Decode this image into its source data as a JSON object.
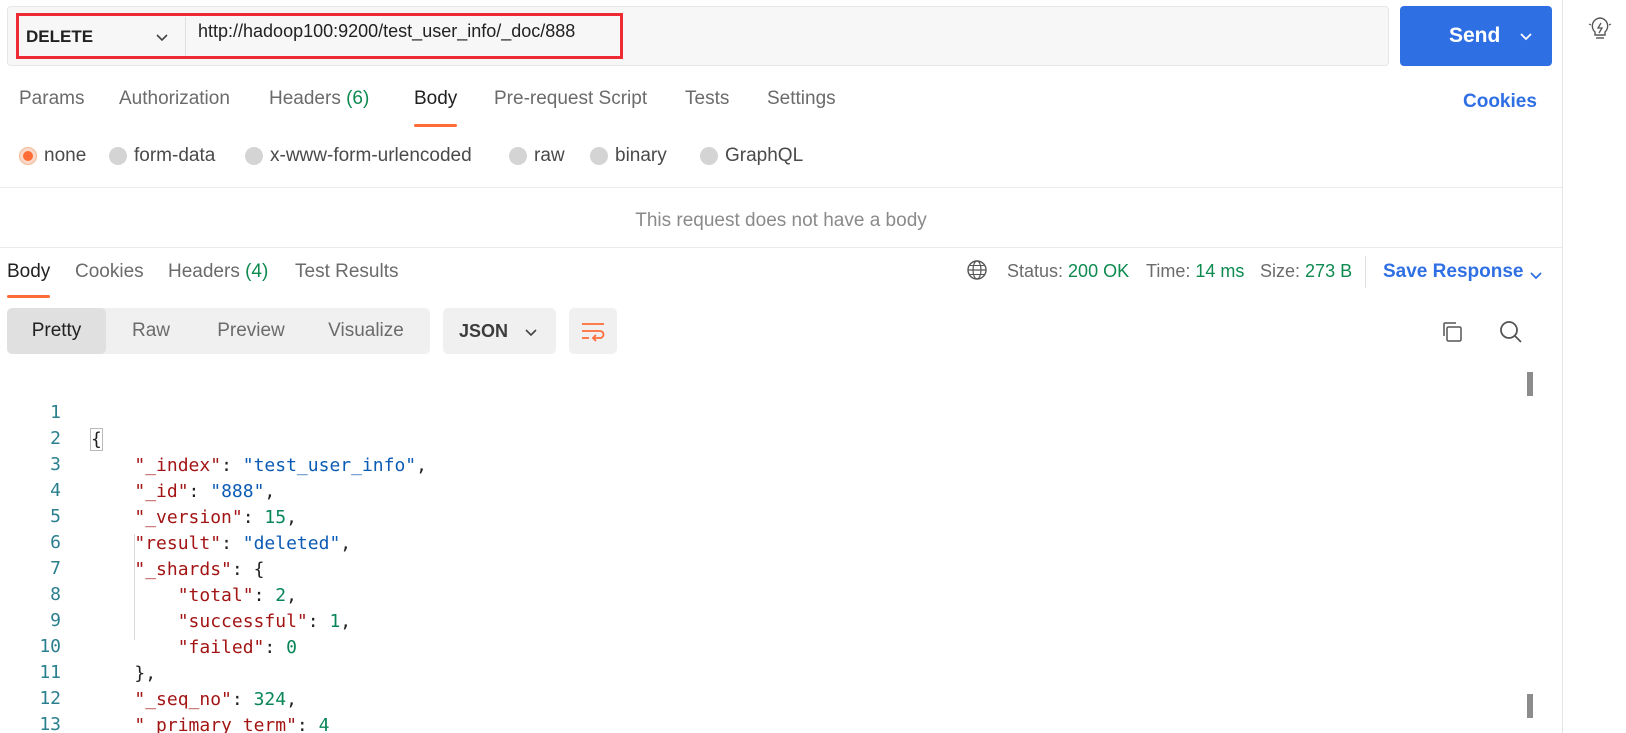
{
  "request": {
    "method": "DELETE",
    "url": "http://hadoop100:9200/test_user_info/_doc/888",
    "send_label": "Send"
  },
  "request_tabs": [
    {
      "label": "Params"
    },
    {
      "label": "Authorization"
    },
    {
      "label": "Headers",
      "count": "(6)"
    },
    {
      "label": "Body"
    },
    {
      "label": "Pre-request Script"
    },
    {
      "label": "Tests"
    },
    {
      "label": "Settings"
    }
  ],
  "cookies_label": "Cookies",
  "body_types": [
    "none",
    "form-data",
    "x-www-form-urlencoded",
    "raw",
    "binary",
    "GraphQL"
  ],
  "no_body_message": "This request does not have a body",
  "response_tabs": [
    {
      "label": "Body"
    },
    {
      "label": "Cookies"
    },
    {
      "label": "Headers",
      "count": "(4)"
    },
    {
      "label": "Test Results"
    }
  ],
  "status": {
    "status_label": "Status:",
    "status_value": "200 OK",
    "time_label": "Time:",
    "time_value": "14 ms",
    "size_label": "Size:",
    "size_value": "273 B"
  },
  "save_response_label": "Save Response",
  "format_buttons": [
    "Pretty",
    "Raw",
    "Preview",
    "Visualize"
  ],
  "language": "JSON",
  "line_numbers": [
    "1",
    "2",
    "3",
    "4",
    "5",
    "6",
    "7",
    "8",
    "9",
    "10",
    "11",
    "12",
    "13"
  ],
  "response_json": {
    "index_key": "\"_index\"",
    "index_value": "\"test_user_info\"",
    "id_key": "\"_id\"",
    "id_value": "\"888\"",
    "version_key": "\"_version\"",
    "version_value": "15",
    "result_key": "\"result\"",
    "result_value": "\"deleted\"",
    "shards_key": "\"_shards\"",
    "total_key": "\"total\"",
    "total_value": "2",
    "successful_key": "\"successful\"",
    "successful_value": "1",
    "failed_key": "\"failed\"",
    "failed_value": "0",
    "seq_no_key": "\"_seq_no\"",
    "seq_no_value": "324",
    "primary_term_key": "\"_primary_term\"",
    "primary_term_value": "4"
  },
  "colors": {
    "accent": "#ff6c37",
    "send_button": "#2f6fe4",
    "status_green": "#0d8a4f",
    "highlight_box": "#ee2a35"
  }
}
